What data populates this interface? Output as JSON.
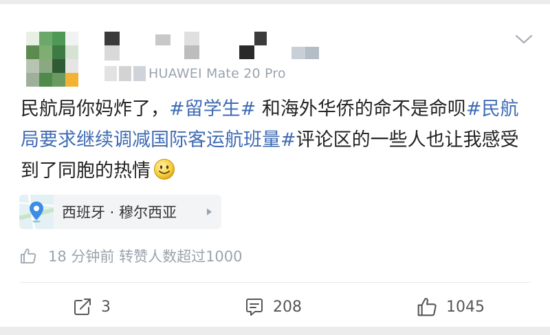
{
  "post": {
    "device": "HUAWEI Mate 20 Pro",
    "text_segments": [
      {
        "text": "民航局你妈炸了，",
        "hashtag": false
      },
      {
        "text": "#留学生#",
        "hashtag": true
      },
      {
        "text": " 和海外华侨的命不是命呗",
        "hashtag": false
      },
      {
        "text": "#民航局要求继续调减国际客运航班量#",
        "hashtag": true
      },
      {
        "text": "评论区的一些人也让我感受到了同胞的热情",
        "hashtag": false
      }
    ],
    "emoji": "smiley-emoji"
  },
  "location": {
    "label": "西班牙 · 穆尔西亚",
    "icon": "map-pin-icon"
  },
  "like_info": {
    "icon": "thumbs-up-icon",
    "text": "18 分钟前  转赞人数超过1000"
  },
  "actions": {
    "repost_count": "3",
    "comment_count": "208",
    "like_count": "1045"
  },
  "colors": {
    "hashtag": "#3f6bb3",
    "meta_gray": "#9aa3ad",
    "background": "#ececec"
  }
}
